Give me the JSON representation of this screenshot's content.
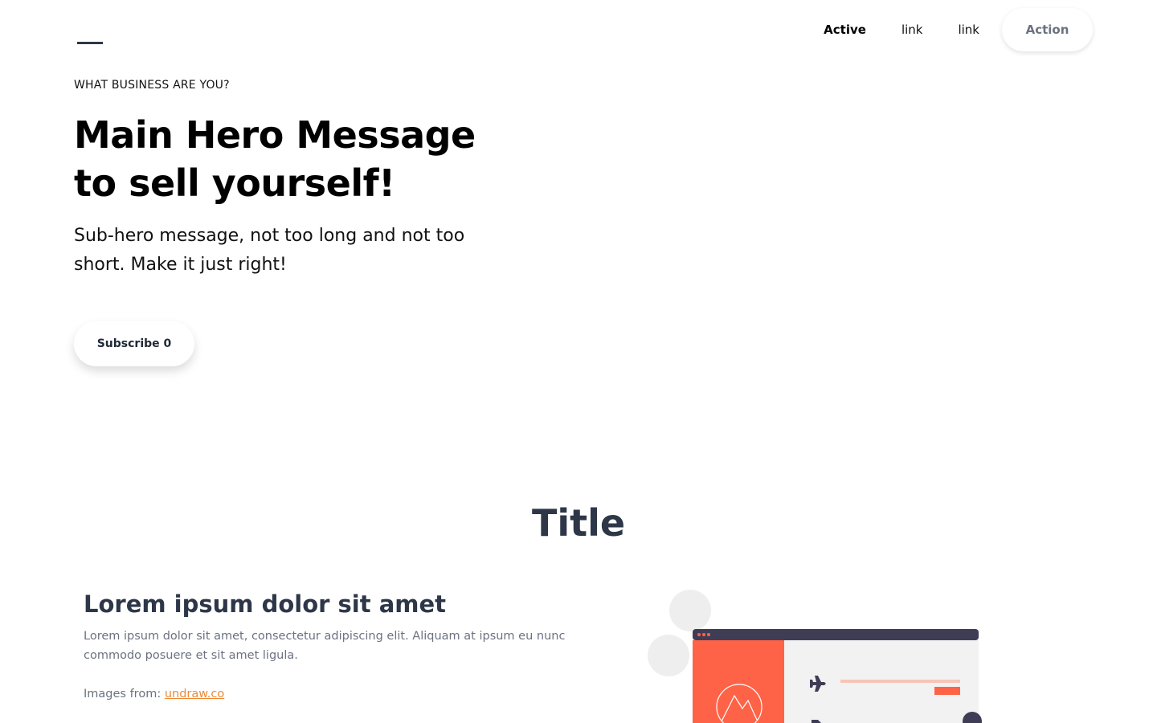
{
  "nav": {
    "links": [
      {
        "label": "Active",
        "active": true
      },
      {
        "label": "link",
        "active": false
      },
      {
        "label": "link",
        "active": false
      }
    ],
    "action_label": "Action"
  },
  "hero": {
    "eyebrow": "WHAT BUSINESS ARE YOU?",
    "title_line1": "Main Hero Message",
    "title_line2": "to sell yourself!",
    "subtitle": "Sub-hero message, not too long and not too short. Make it just right!",
    "subscribe_label": "Subscribe 0"
  },
  "section": {
    "title": "Title",
    "feature_heading": "Lorem ipsum dolor sit amet",
    "feature_text": "Lorem ipsum dolor sit amet, consectetur adipiscing elit. Aliquam at ipsum eu nunc commodo posuere et sit amet ligula.",
    "credit_prefix": "Images from: ",
    "credit_link": "undraw.co"
  },
  "colors": {
    "accent_orange": "#ff6347",
    "dark_slate": "#2d3748",
    "link_orange": "#ed8936"
  },
  "icons": [
    "airplane-icon",
    "mountain-icon"
  ]
}
